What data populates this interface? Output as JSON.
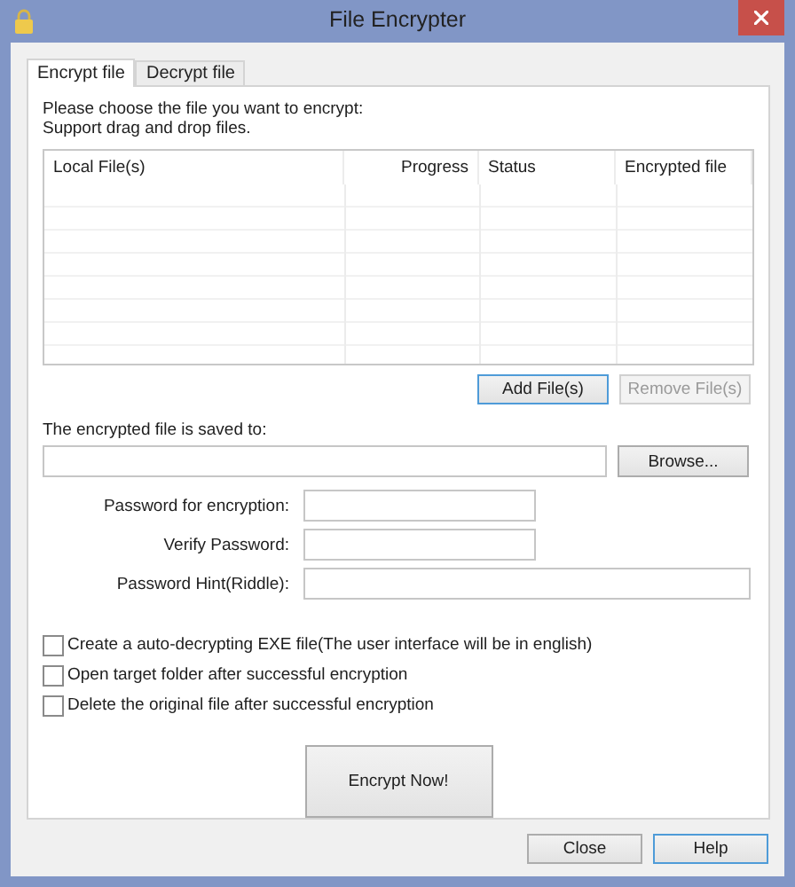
{
  "window": {
    "title": "File Encrypter"
  },
  "tabs": [
    {
      "label": "Encrypt file",
      "selected": true
    },
    {
      "label": "Decrypt file",
      "selected": false
    }
  ],
  "instructions": [
    "Please choose the file you want to encrypt:",
    "Support drag and drop files."
  ],
  "table": {
    "columns": [
      {
        "label": "Local File(s)"
      },
      {
        "label": "Progress"
      },
      {
        "label": "Status"
      },
      {
        "label": "Encrypted file"
      }
    ]
  },
  "file_buttons": [
    {
      "label": "Add File(s)",
      "disabled": false,
      "highlighted": true
    },
    {
      "label": "Remove File(s)",
      "disabled": true,
      "highlighted": false
    }
  ],
  "save_to": {
    "label": "The encrypted file is saved to:",
    "browse": "Browse..."
  },
  "password_fields": [
    {
      "label": "Password for encryption:"
    },
    {
      "label": "Verify Password:"
    },
    {
      "label": "Password Hint(Riddle):"
    }
  ],
  "options": [
    {
      "label": "Create a auto-decrypting EXE file(The user interface will be in english)",
      "checked": false
    },
    {
      "label": "Open target folder after successful encryption",
      "checked": false
    },
    {
      "label": "Delete the original file after successful encryption",
      "checked": false
    }
  ],
  "encrypt_button": "Encrypt Now!",
  "footer_buttons": [
    {
      "label": "Close",
      "highlighted": false
    },
    {
      "label": "Help",
      "highlighted": true
    }
  ]
}
